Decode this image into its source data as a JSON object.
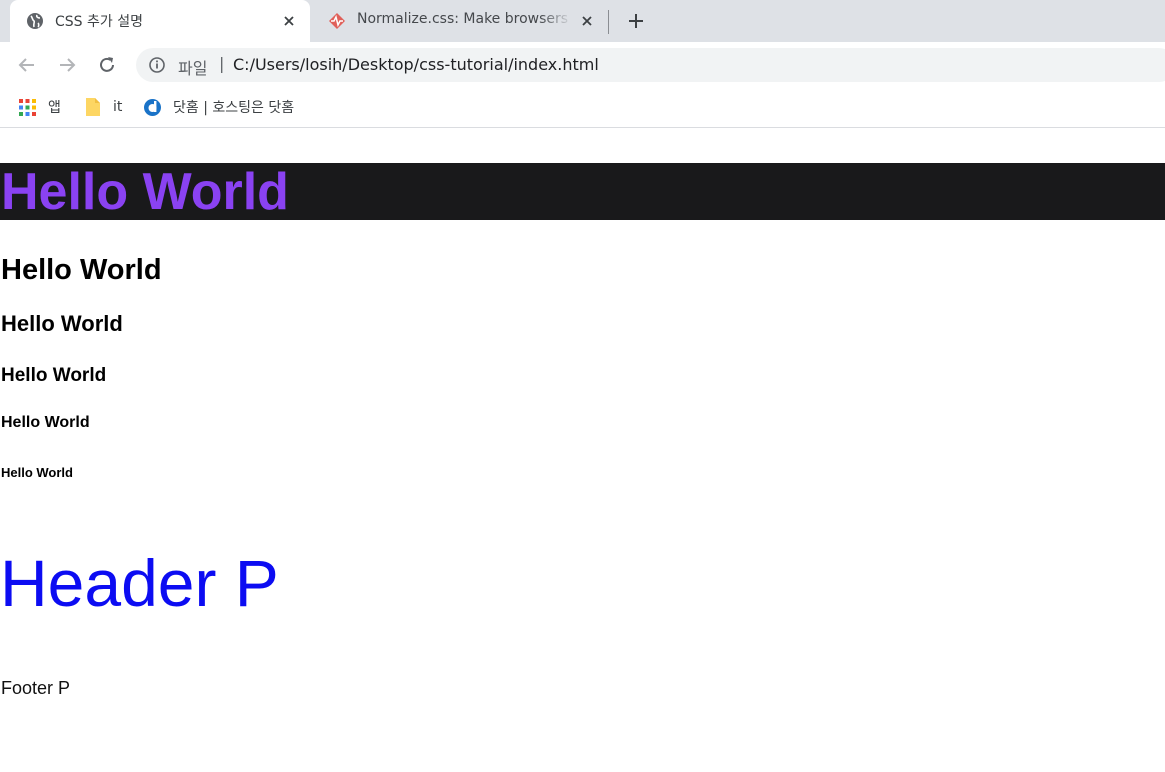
{
  "tabs": [
    {
      "title": "CSS 추가 설명",
      "icon": "globe-icon",
      "active": true
    },
    {
      "title": "Normalize.css: Make browsers re",
      "icon": "normalize-logo-icon",
      "active": false
    }
  ],
  "toolbar": {
    "scheme_label": "파일",
    "url": "C:/Users/losih/Desktop/css-tutorial/index.html"
  },
  "bookmarks": [
    {
      "label": "앱",
      "icon": "apps-grid-icon"
    },
    {
      "label": "it",
      "icon": "folder-icon"
    },
    {
      "label": "닷홈 | 호스팅은 닷홈",
      "icon": "dothome-icon"
    }
  ],
  "content": {
    "h1": "Hello World",
    "h2": "Hello World",
    "h3": "Hello World",
    "h4": "Hello World",
    "h5": "Hello World",
    "h6": "Hello World",
    "header_p": "Header P",
    "footer_p": "Footer P"
  },
  "colors": {
    "hero_background": "#19191b",
    "hero_text": "#8a42f2",
    "header_p_text": "#0c0cf2"
  }
}
